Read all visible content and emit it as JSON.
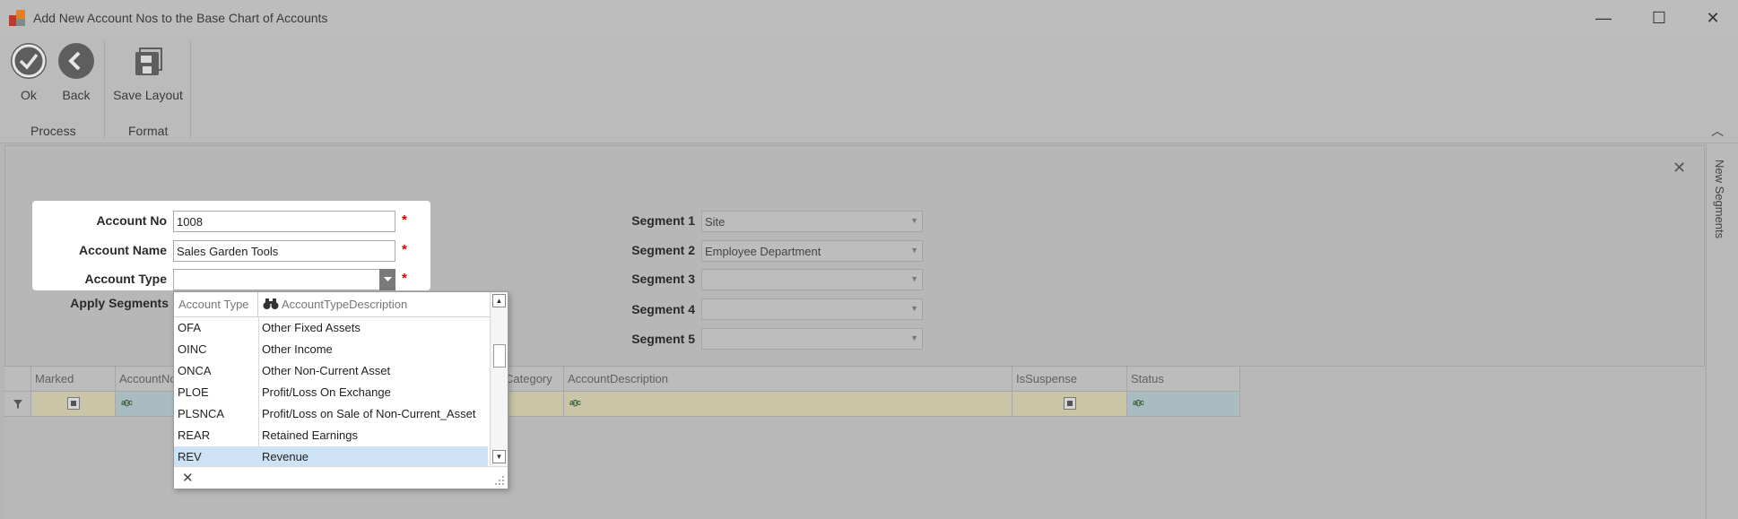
{
  "window": {
    "title": "Add New Account Nos to the Base Chart of Accounts",
    "minimize": "—",
    "maximize": "☐",
    "close": "✕"
  },
  "ribbon": {
    "ok_label": "Ok",
    "back_label": "Back",
    "save_layout_label": "Save Layout",
    "group_process": "Process",
    "group_format": "Format"
  },
  "side_tab": "New Segments",
  "form": {
    "account_no_label": "Account No",
    "account_no_value": "1008",
    "account_name_label": "Account Name",
    "account_name_value": "Sales Garden Tools",
    "account_type_label": "Account Type",
    "account_type_value": "",
    "apply_segments_label": "Apply Segments",
    "required_mark": "*"
  },
  "segments": [
    {
      "label": "Segment 1",
      "value": "Site"
    },
    {
      "label": "Segment 2",
      "value": "Employee Department"
    },
    {
      "label": "Segment 3",
      "value": ""
    },
    {
      "label": "Segment 4",
      "value": ""
    },
    {
      "label": "Segment 5",
      "value": ""
    }
  ],
  "grid": {
    "columns": [
      "Marked",
      "AccountNo",
      "Category",
      "AccountDescription",
      "IsSuspense",
      "Status"
    ]
  },
  "dropdown": {
    "col1_header": "Account Type",
    "col2_header": "AccountTypeDescription",
    "rows": [
      {
        "code": "OFA",
        "desc": "Other Fixed Assets"
      },
      {
        "code": "OINC",
        "desc": "Other Income"
      },
      {
        "code": "ONCA",
        "desc": "Other Non-Current Asset"
      },
      {
        "code": "PLOE",
        "desc": "Profit/Loss On Exchange"
      },
      {
        "code": "PLSNCA",
        "desc": "Profit/Loss on Sale of Non-Current_Asset"
      },
      {
        "code": "REAR",
        "desc": "Retained Earnings"
      },
      {
        "code": "REV",
        "desc": "Revenue"
      }
    ],
    "selected_index": 6,
    "clear_label": "✕"
  },
  "colors": {
    "selection": "#cde3f5",
    "required": "#dd0000",
    "filter_row": "#c9c5a6"
  }
}
